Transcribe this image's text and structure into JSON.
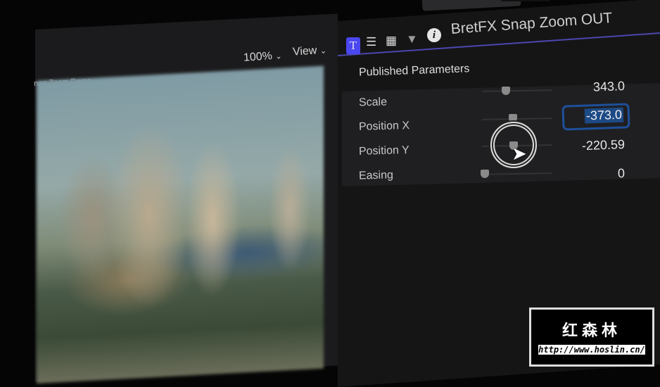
{
  "viewer": {
    "zoom": "100%",
    "view": "View",
    "project_title": "nap Zoom Demo"
  },
  "inspector": {
    "title": "BretFX Snap Zoom OUT",
    "tabs": [
      {
        "icon": "title-icon",
        "label": "T"
      },
      {
        "icon": "text-icon"
      },
      {
        "icon": "video-icon"
      },
      {
        "icon": "generator-icon"
      },
      {
        "icon": "info-icon",
        "label": "i"
      }
    ],
    "section": "Published Parameters",
    "params": [
      {
        "label": "Scale",
        "value": "343.0",
        "slider": 0.35
      },
      {
        "label": "Position X",
        "value": "-373.0",
        "slider": 0.45,
        "editing": true
      },
      {
        "label": "Position Y",
        "value": "-220.59",
        "slider": 0.45
      },
      {
        "label": "Easing",
        "value": "0",
        "slider": 0.0
      }
    ]
  },
  "watermark": {
    "name": "红森林",
    "url": "http://www.hoslin.cn/"
  },
  "colors": {
    "accent": "#4b47f0",
    "edit_border": "#1e4f9a",
    "selection": "#1d4a86"
  }
}
